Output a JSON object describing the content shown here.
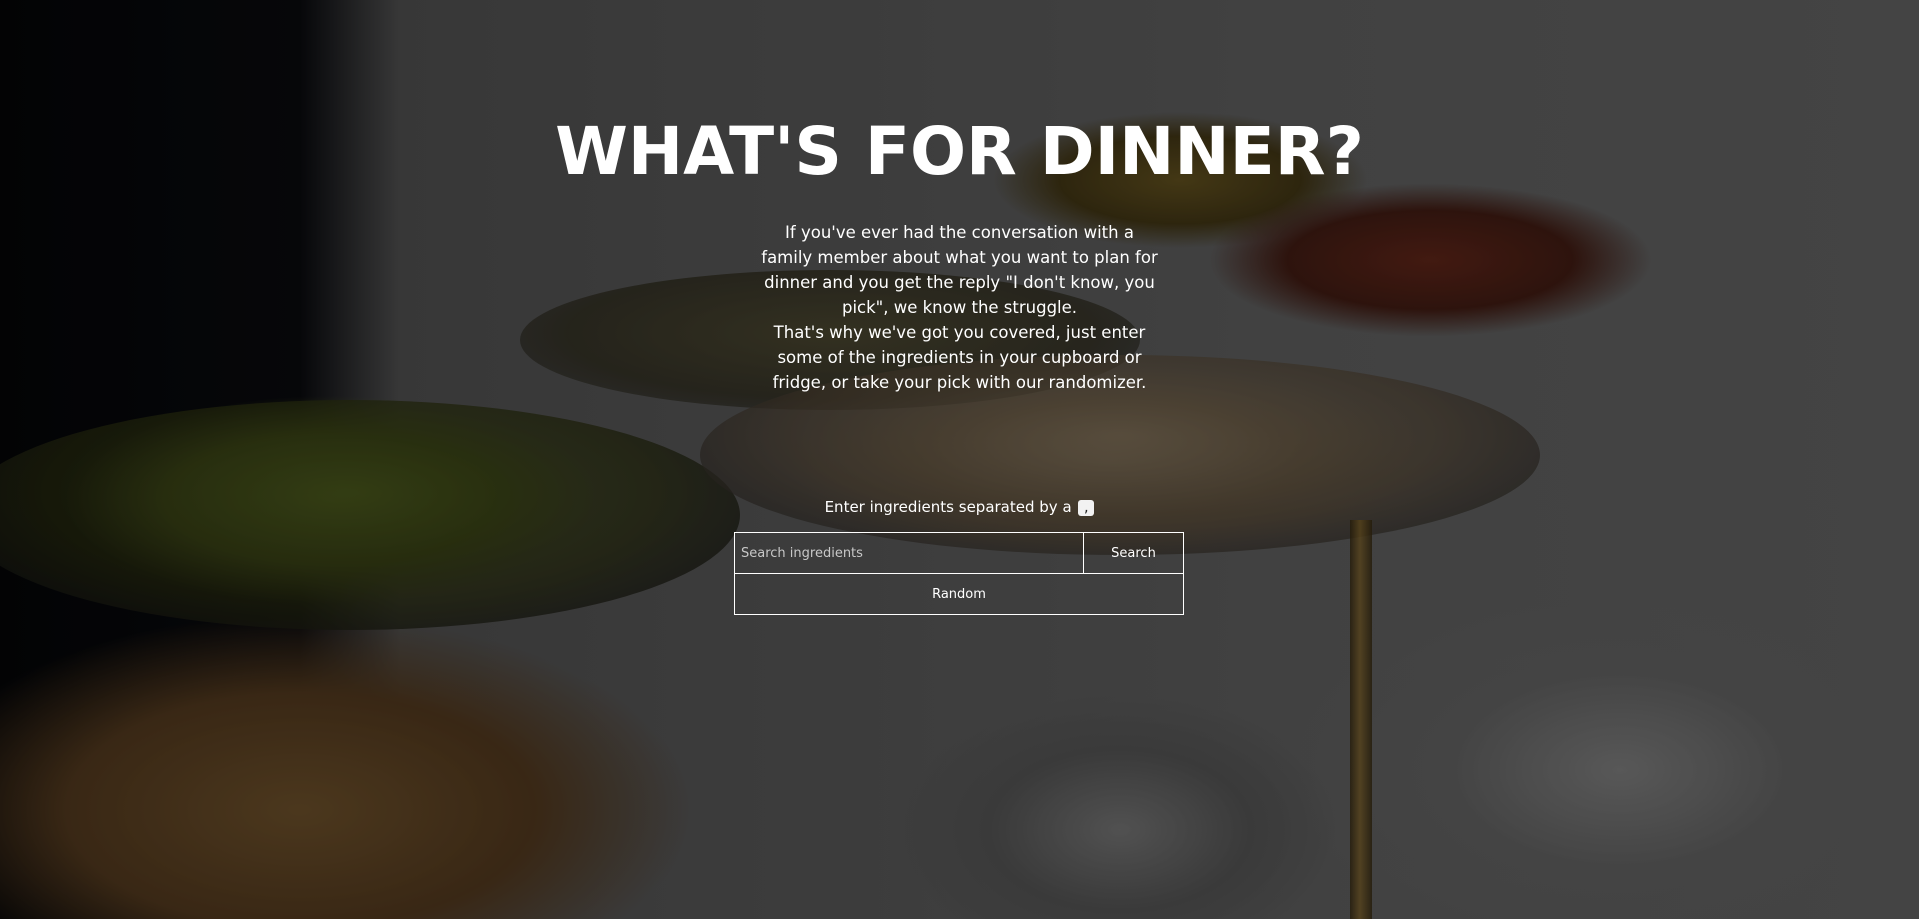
{
  "hero": {
    "title": "WHAT'S FOR DINNER?",
    "intro_paragraph_1": "If you've ever had the conversation with a family member about what you want to plan for dinner and you get the reply \"I don't know, you pick\", we know the struggle.",
    "intro_paragraph_2": "That's why we've got you covered, just enter some of the ingredients in your cupboard or fridge, or take your pick with our randomizer."
  },
  "search": {
    "label": "Enter ingredients separated by a",
    "separator_key": ",",
    "placeholder": "Search ingredients",
    "value": "",
    "button_label": "Search"
  },
  "random": {
    "button_label": "Random"
  },
  "colors": {
    "text": "#ffffff",
    "border": "#ffffff",
    "overlay": "rgba(0,0,0,0.38)"
  }
}
